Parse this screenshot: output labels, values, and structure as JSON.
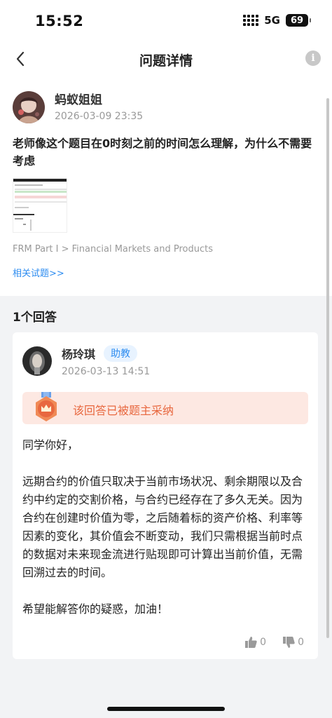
{
  "status_bar": {
    "time": "15:52",
    "network": "5G",
    "battery": "69"
  },
  "nav": {
    "title": "问题详情",
    "back_icon": "chevron-left-icon",
    "info_icon": "info-icon",
    "info_glyph": "i"
  },
  "question": {
    "user_name": "蚂蚁姐姐",
    "time": "2026-03-09 23:35",
    "text": "老师像这个题目在0时刻之前的时间怎么理解，为什么不需要考虑",
    "path": "FRM Part I > Financial Markets and Products",
    "related_link": "相关试题>>"
  },
  "answers": {
    "count_label": "1个回答",
    "items": [
      {
        "user_name": "杨玲琪",
        "badge": "助教",
        "time": "2026-03-13 14:51",
        "accepted_label": "该回答已被题主采纳",
        "paragraphs": [
          "同学你好，",
          "远期合约的价值只取决于当前市场状况、剩余期限以及合约中约定的交割价格，与合约已经存在了多久无关。因为合约在创建时价值为零，之后随着标的资产价格、利率等因素的变化，其价值会不断变动，我们只需根据当前时点的数据对未来现金流进行贴现即可计算出当前价值，无需回溯过去的时间。",
          "希望能解答你的疑惑，加油！"
        ],
        "likes": "0",
        "dislikes": "0"
      }
    ]
  },
  "colors": {
    "accent": "#2d8cf0",
    "accepted_bg": "#fde8e2",
    "accepted_text": "#e8683f",
    "page_bg": "#f2f3f5"
  }
}
